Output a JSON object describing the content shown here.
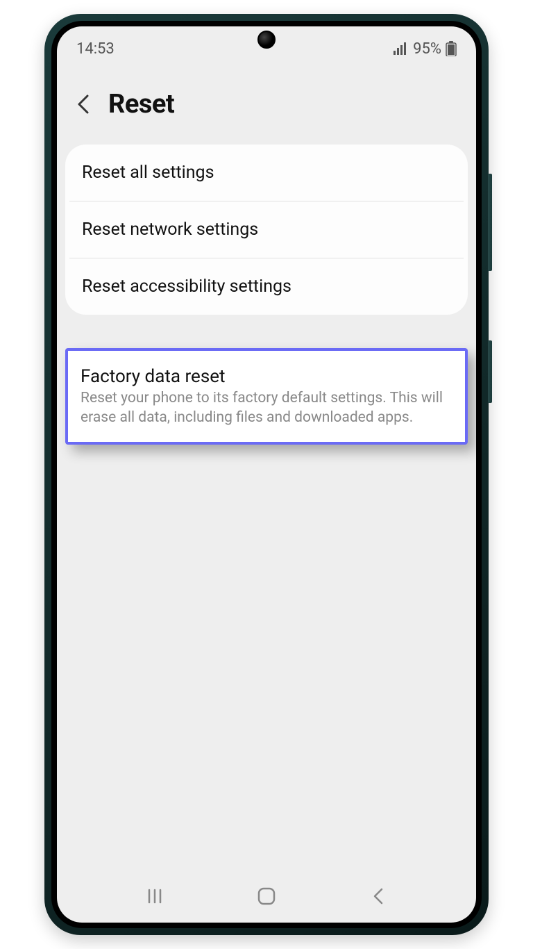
{
  "status": {
    "time": "14:53",
    "battery_text": "95%"
  },
  "header": {
    "title": "Reset"
  },
  "options": [
    {
      "title": "Reset all settings"
    },
    {
      "title": "Reset network settings"
    },
    {
      "title": "Reset accessibility settings"
    }
  ],
  "factory": {
    "title": "Factory data reset",
    "desc": "Reset your phone to its factory default settings. This will erase all data, including files and downloaded apps."
  }
}
